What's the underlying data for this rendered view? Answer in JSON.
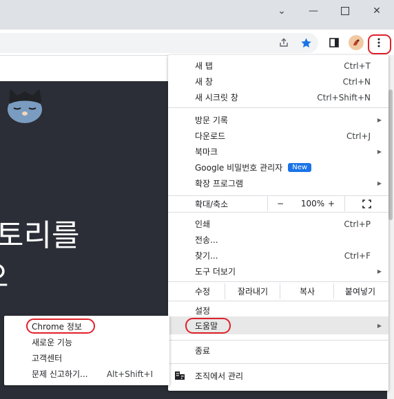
{
  "window": {
    "minimize_glyph": "—",
    "maximize_glyph": "☐",
    "close_glyph": "✕",
    "tabs_dropdown_glyph": "⌄"
  },
  "page": {
    "hero_line1": "토리를",
    "hero_line2": "으"
  },
  "menu": {
    "new_tab": {
      "label": "새 탭",
      "shortcut": "Ctrl+T"
    },
    "new_window": {
      "label": "새 창",
      "shortcut": "Ctrl+N"
    },
    "incognito": {
      "label": "새 시크릿 창",
      "shortcut": "Ctrl+Shift+N"
    },
    "history": {
      "label": "방문 기록"
    },
    "downloads": {
      "label": "다운로드",
      "shortcut": "Ctrl+J"
    },
    "bookmarks": {
      "label": "북마크"
    },
    "passwords": {
      "label": "Google 비밀번호 관리자",
      "badge": "New"
    },
    "extensions": {
      "label": "확장 프로그램"
    },
    "zoom": {
      "label": "확대/축소",
      "minus": "−",
      "value": "100%",
      "plus": "+"
    },
    "print": {
      "label": "인쇄",
      "shortcut": "Ctrl+P"
    },
    "cast": {
      "label": "전송..."
    },
    "find": {
      "label": "찾기...",
      "shortcut": "Ctrl+F"
    },
    "more_tools": {
      "label": "도구 더보기"
    },
    "edit": {
      "label": "수정",
      "cut": "잘라내기",
      "copy": "복사",
      "paste": "붙여넣기"
    },
    "settings": {
      "label": "설정"
    },
    "help": {
      "label": "도움말"
    },
    "exit": {
      "label": "종료"
    },
    "managed": {
      "label": "조직에서 관리"
    }
  },
  "submenu": {
    "about": {
      "label": "Chrome 정보"
    },
    "whats_new": {
      "label": "새로운 기능"
    },
    "help_center": {
      "label": "고객센터"
    },
    "report": {
      "label": "문제 신고하기...",
      "shortcut": "Alt+Shift+I"
    }
  },
  "colors": {
    "highlight": "#e0202a",
    "accent": "#1a73e8",
    "star": "#1a73e8"
  }
}
